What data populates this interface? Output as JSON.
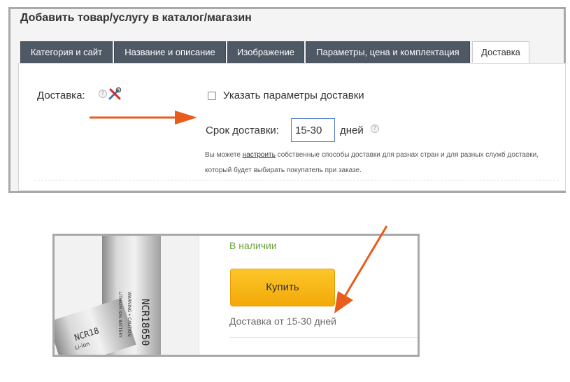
{
  "panel": {
    "title": "Добавить товар/услугу в каталог/магазин",
    "tabs": [
      {
        "label": "Категория и сайт"
      },
      {
        "label": "Название и описание"
      },
      {
        "label": "Изображение"
      },
      {
        "label": "Параметры, цена и комплектация"
      },
      {
        "label": "Доставка"
      }
    ],
    "active_tab": "Доставка",
    "delivery_label": "Доставка:",
    "checkbox_label": "Указать параметры доставки",
    "checkbox_checked": false,
    "term_label": "Срок доставки:",
    "term_value": "15-30",
    "term_unit": "дней",
    "help_icon": "?",
    "note_before": "Вы можете ",
    "note_link": "настроить",
    "note_after": " собственные способы доставки для разнах стран и для разных служб доставки, который будет выбирать покупатель при заказе."
  },
  "product": {
    "status": "В наличии",
    "buy_label": "Купить",
    "delivery_text": "Доставка от 15-30 дней",
    "battery_label": "NCR18650",
    "battery_label_short": "NCR18",
    "battery_sub": "Li-ion",
    "colors": {
      "in_stock": "#6aa43a",
      "buy_button": "#f8b617",
      "arrow": "#e85c1c",
      "tab_dark": "#4f5965"
    }
  },
  "icons": [
    "help-icon",
    "tools-icon",
    "checkbox-icon",
    "arrow-annotation",
    "battery-image"
  ]
}
